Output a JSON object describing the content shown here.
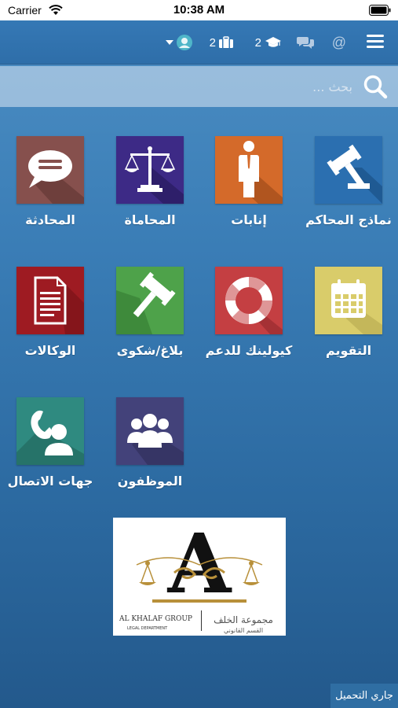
{
  "status_bar": {
    "carrier": "Carrier",
    "time": "10:38 AM"
  },
  "nav": {
    "grad_count": "2",
    "briefcase_count": "2",
    "at_symbol": "@",
    "icons": [
      "menu-icon",
      "at-icon",
      "chat-icon",
      "graduation-cap-icon",
      "briefcase-icon",
      "user-avatar-icon",
      "caret-down-icon"
    ]
  },
  "search": {
    "placeholder": "بحث ..."
  },
  "tiles": [
    {
      "label": "نماذج المحاكم",
      "icon": "gavel-icon",
      "color": "#2b6fb0"
    },
    {
      "label": "إنابات",
      "icon": "person-suit-icon",
      "color": "#d46a2a"
    },
    {
      "label": "المحاماة",
      "icon": "scales-icon",
      "color": "#3d2a86"
    },
    {
      "label": "المحادثة",
      "icon": "speech-bubble-icon",
      "color": "#86504d"
    },
    {
      "label": "التقويم",
      "icon": "calendar-icon",
      "color": "#d9cc6a"
    },
    {
      "label": "كيولينك للدعم",
      "icon": "lifebuoy-icon",
      "color": "#c43f42"
    },
    {
      "label": "بلاغ/شكوى",
      "icon": "gavel-report-icon",
      "color": "#4ea24a"
    },
    {
      "label": "الوكالات",
      "icon": "document-icon",
      "color": "#9e1b22"
    },
    {
      "label": "جهات الاتصال",
      "icon": "contact-phone-icon",
      "color": "#2f8a80"
    },
    {
      "label": "الموظفون",
      "icon": "group-icon",
      "color": "#43427a"
    }
  ],
  "logo": {
    "letter": "A",
    "brand_en": "AL KHALAF GROUP",
    "dept_en": "LEGAL DEPARTMENT",
    "brand_ar": "مجموعة الخلف",
    "dept_ar": "القسم القانوني"
  },
  "footer": {
    "loading_text": "جاري التحميل"
  }
}
